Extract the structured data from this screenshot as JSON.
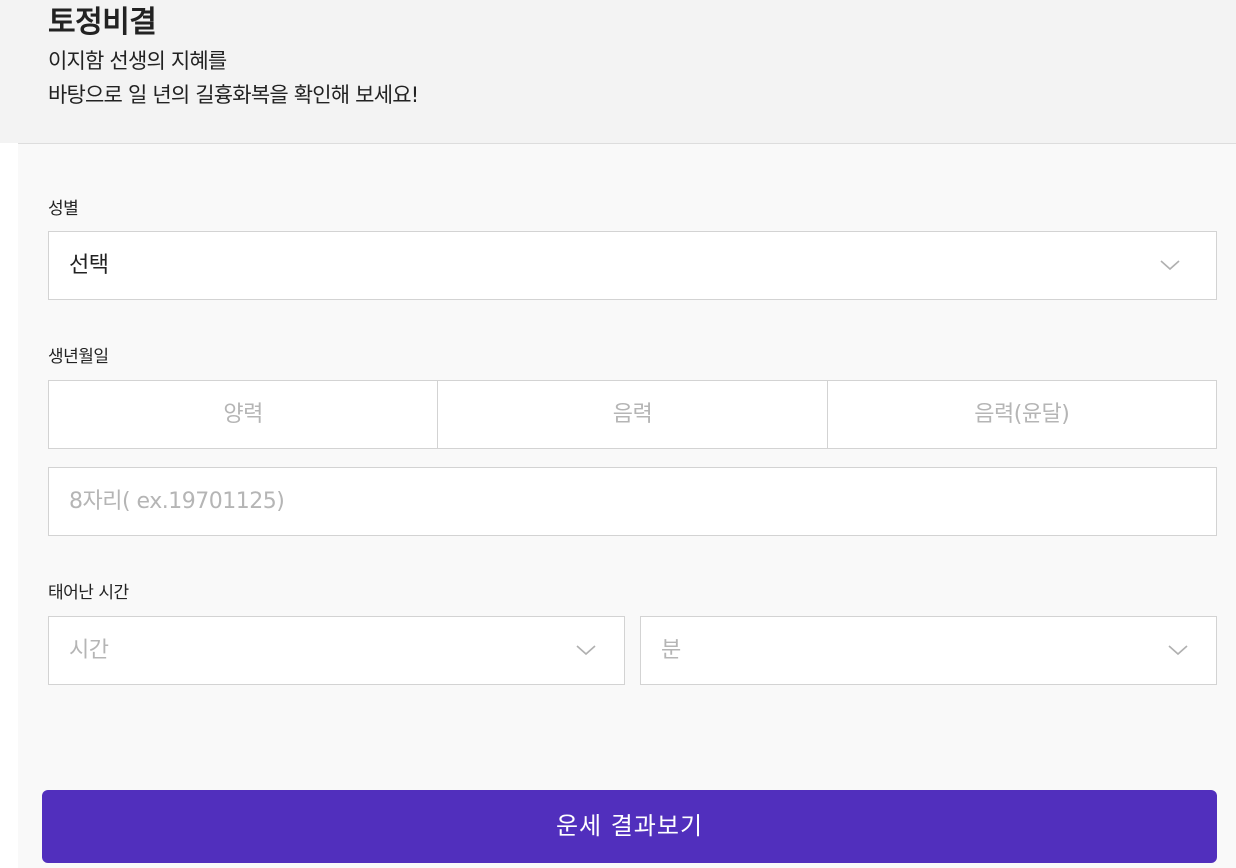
{
  "header": {
    "title": "토정비결",
    "desc_line1": "이지함 선생의 지혜를",
    "desc_line2": "바탕으로 일 년의 길흉화복을 확인해 보세요!"
  },
  "form": {
    "gender": {
      "label": "성별",
      "selected": "선택"
    },
    "birth": {
      "label": "생년월일",
      "calendar_options": [
        "양력",
        "음력",
        "음력(윤달)"
      ],
      "date_placeholder": "8자리( ex.19701125)"
    },
    "birth_time": {
      "label": "태어난 시간",
      "hour_placeholder": "시간",
      "minute_placeholder": "분"
    },
    "submit_label": "운세 결과보기"
  },
  "icons": {
    "dropdown": "chevron-down-icon"
  },
  "colors": {
    "accent": "#512fbd",
    "placeholder": "#b5b5b5",
    "border": "#d3d3d3"
  }
}
